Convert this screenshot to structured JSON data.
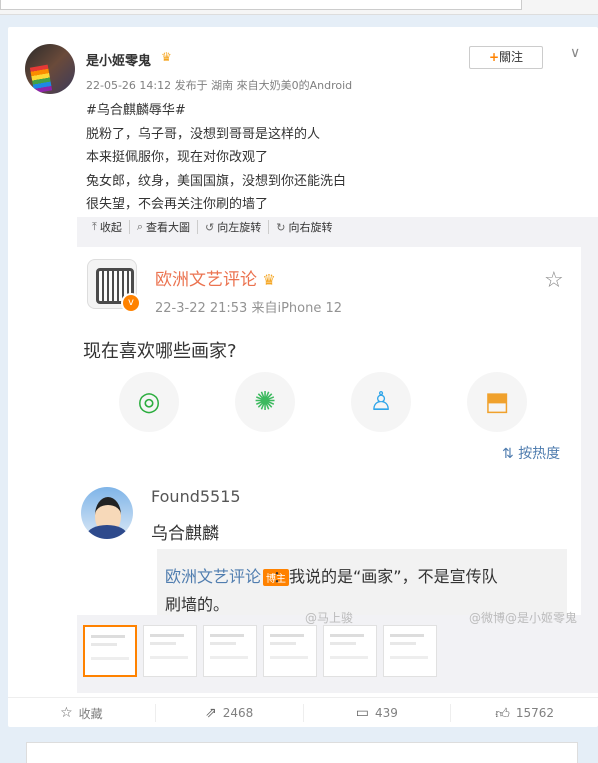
{
  "post": {
    "username": "是小姬零鬼",
    "vip_icon": "crown-icon",
    "meta": "22-05-26 14:12 发布于 湖南 來自大奶美0的Android",
    "follow_label": "關注",
    "text": [
      "#乌合麒麟辱华#",
      "脱粉了，乌子哥，没想到哥哥是这样的人",
      "本来挺佩服你，现在对你改观了",
      "兔女郎，纹身，美国国旗，没想到你还能洗白",
      "很失望，不会再关注你刷的墙了"
    ]
  },
  "media_toolbar": [
    "收起",
    "查看大圖",
    "向左旋转",
    "向右旋转"
  ],
  "screenshot": {
    "account": "欧洲文艺评论",
    "meta": "22-3-22 21:53  来自iPhone 12",
    "question": "现在喜欢哪些画家?",
    "sort_label": "按热度",
    "commenter": "Found5515",
    "comment": "乌合麒麟",
    "reply_author": "欧洲文艺评论",
    "reply_badge": "博主",
    "reply_text": "：我说的是“画家”，不是宣传队",
    "reply_text2": "刷墙的。",
    "watermark1": "@马上骏",
    "watermark2": "@微博@是小姬零鬼"
  },
  "footer": {
    "favorite": "收藏",
    "repost": "2468",
    "comment": "439",
    "like": "15762"
  }
}
